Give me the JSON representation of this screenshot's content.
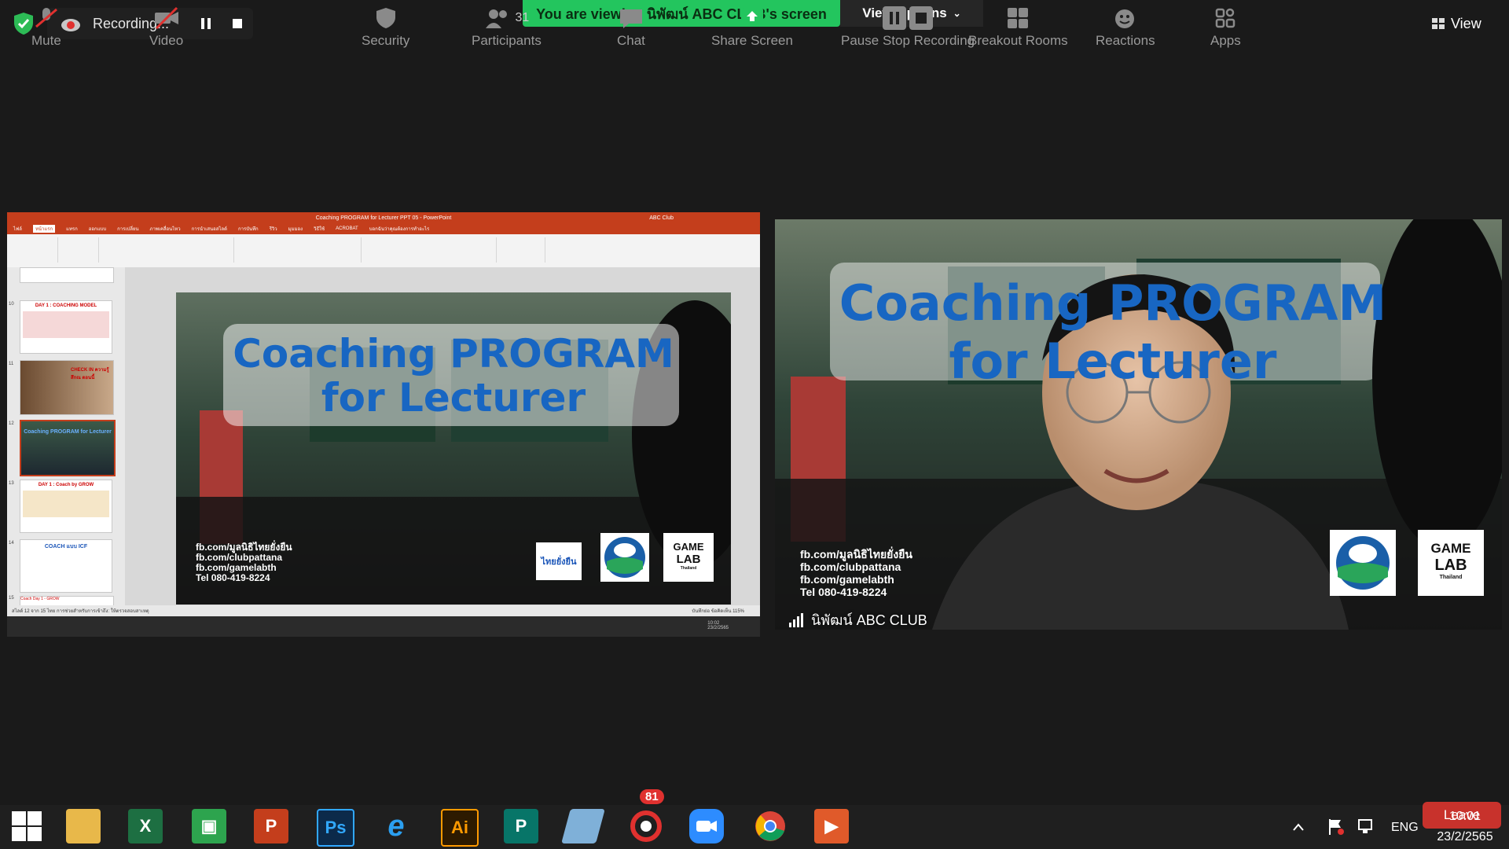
{
  "top": {
    "recording_label": "Recording...",
    "banner_text": "You are viewing นิพัฒน์ ABC CLUB's screen",
    "view_options_label": "View Options",
    "view_label": "View"
  },
  "share": {
    "window_title": "Coaching PROGRAM for Lecturer PPT 05 - PowerPoint",
    "account_name": "ABC Club",
    "ribbon_tabs": [
      "ไฟล์",
      "หน้าแรก",
      "แทรก",
      "ออกแบบ",
      "การเปลี่ยน",
      "ภาพเคลื่อนไหว",
      "การนำเสนอสไลด์",
      "การบันทึก",
      "รีวิว",
      "มุมมอง",
      "วิธีใช้",
      "ACROBAT",
      "บอกฉันว่าคุณต้องการทำอะไร"
    ],
    "thumb_numbers": [
      "10",
      "11",
      "12",
      "13",
      "14",
      "15"
    ],
    "thumb_titles": [
      "DAY 1 : COACHING MODEL",
      "CHECK IN ความรู้สึกณ ตอนนี้",
      "Coaching PROGRAM for Lecturer",
      "DAY 1 : Coach by GROW",
      "COACH แบบ ICF",
      "Coach Day 1 - GROW"
    ],
    "status_text": "สไลด์ 12 จาก 15   ไทย   การช่วยสำหรับการเข้าถึง: ให้ตรวจสอบสาเหตุ",
    "status_right": "บันทึกย่อ   ข้อคิดเห็น   115%",
    "slide": {
      "title_line1": "Coaching PROGRAM",
      "title_line2": "for Lecturer",
      "contacts": [
        "fb.com/มูลนิธิไทยยั่งยืน",
        "fb.com/clubpattana",
        "fb.com/gamelabth",
        "Tel 080-419-8224"
      ],
      "logo1": "ไทยยั่งยืน",
      "logo3_line1": "GAME",
      "logo3_line2": "LAB",
      "logo3_line3": "Thailand"
    },
    "mini_clock": "10:02\n23/2/2565"
  },
  "camera": {
    "participant_name": "นิพัฒน์ ABC CLUB",
    "bg_title_line1": "Coaching PROGRAM",
    "bg_title_line2": "for Lecturer",
    "contacts": [
      "fb.com/มูลนิธิไทยยั่งยืน",
      "fb.com/clubpattana",
      "fb.com/gamelabth",
      "Tel 080-419-8224"
    ]
  },
  "toolbar": {
    "participants_count": "31",
    "chat_badge": "81",
    "items": {
      "mute": "Mute",
      "video": "Video",
      "security": "Security",
      "participants": "Participants",
      "chat": "Chat",
      "share": "Share Screen",
      "pause": "Pause",
      "stop_recording": "Stop Recording",
      "breakout": "Breakout Rooms",
      "reactions": "Reactions",
      "apps": "Apps",
      "leave": "Leave"
    }
  },
  "taskbar": {
    "apps": [
      "Start",
      "File Explorer",
      "Excel",
      "Project",
      "PowerPoint",
      "Photoshop",
      "Internet Explorer",
      "Illustrator",
      "Publisher",
      "Eraser",
      "PhotoScape",
      "Zoom",
      "Chrome",
      "Presentation"
    ],
    "lang": "ENG",
    "time": "10:01",
    "date": "23/2/2565"
  },
  "colors": {
    "banner_green": "#23c55e",
    "powerpoint_red": "#c43e1c",
    "leave_red": "#c8322c"
  }
}
